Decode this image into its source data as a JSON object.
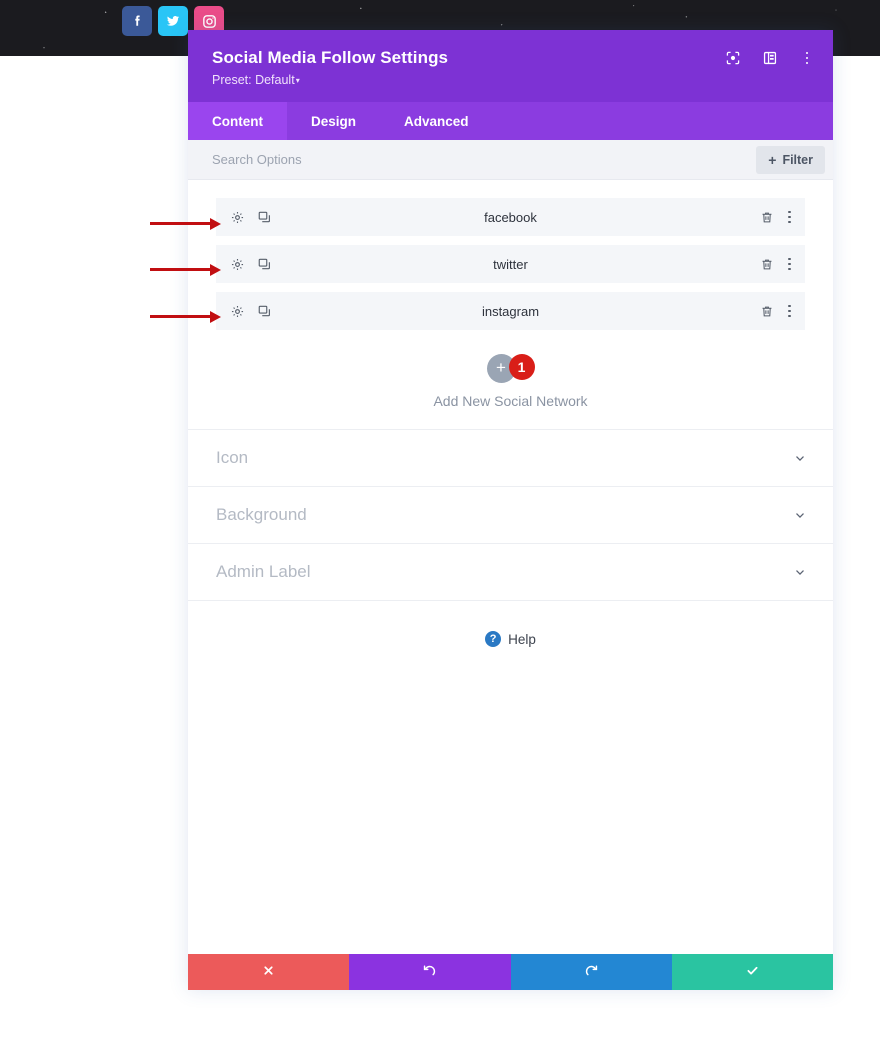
{
  "site_header": {
    "social_icons": [
      {
        "name": "facebook-icon",
        "label": "Facebook",
        "color": "#3b5998"
      },
      {
        "name": "twitter-icon",
        "label": "Twitter",
        "color": "#29c5f6"
      },
      {
        "name": "instagram-icon",
        "label": "Instagram",
        "color": "#ea4c89"
      }
    ]
  },
  "modal": {
    "title": "Social Media Follow Settings",
    "preset_label": "Preset: Default",
    "preset_caret": "▾",
    "header_color": "#7d32d4",
    "header_icons": [
      {
        "name": "focus-target-icon",
        "title": "Focus"
      },
      {
        "name": "layout-panel-icon",
        "title": "Panel Layout"
      },
      {
        "name": "more-options-icon",
        "title": "More Options"
      }
    ],
    "tabs": [
      {
        "label": "Content",
        "active": true
      },
      {
        "label": "Design",
        "active": false
      },
      {
        "label": "Advanced",
        "active": false
      }
    ],
    "search": {
      "placeholder": "Search Options",
      "value": ""
    },
    "filter_button": {
      "plus": "+",
      "label": "Filter"
    },
    "items": [
      {
        "label": "facebook"
      },
      {
        "label": "twitter"
      },
      {
        "label": "instagram"
      }
    ],
    "item_icons": {
      "settings": "gear-icon",
      "duplicate": "duplicate-icon",
      "delete": "trash-icon",
      "more": "more-options-icon"
    },
    "add_new": {
      "plus": "+",
      "badge_count": "1",
      "label": "Add New Social Network",
      "badge_color": "#d91e18"
    },
    "accordion": [
      {
        "label": "Icon"
      },
      {
        "label": "Background"
      },
      {
        "label": "Admin Label"
      }
    ],
    "help": {
      "badge": "?",
      "label": "Help",
      "badge_color": "#2a79c4"
    },
    "footer_buttons": [
      {
        "name": "cancel-button",
        "icon": "close-icon",
        "color": "#ec5a5a"
      },
      {
        "name": "undo-button",
        "icon": "undo-icon",
        "color": "#8b33e0"
      },
      {
        "name": "redo-button",
        "icon": "redo-icon",
        "color": "#2387d3"
      },
      {
        "name": "save-button",
        "icon": "check-icon",
        "color": "#2ac4a1"
      }
    ]
  },
  "annotations": {
    "arrow_color": "#c10e11",
    "arrows": [
      {
        "name": "arrow-facebook-row"
      },
      {
        "name": "arrow-twitter-row"
      },
      {
        "name": "arrow-instagram-row"
      }
    ]
  }
}
